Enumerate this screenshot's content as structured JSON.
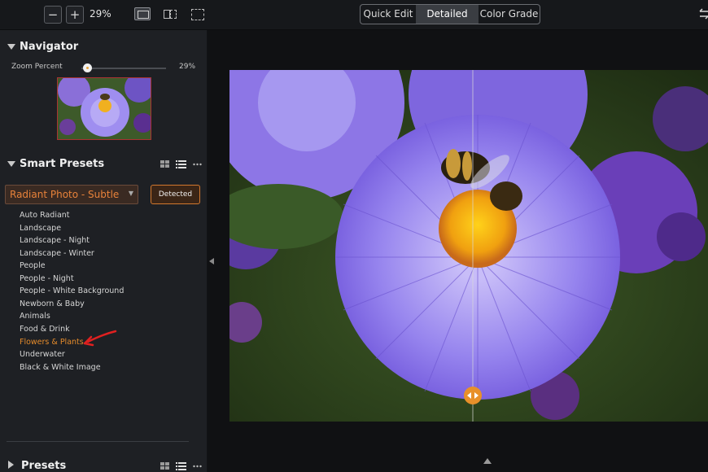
{
  "toolbar": {
    "zoom_out_label": "−",
    "zoom_in_label": "+",
    "zoom_value": "29%",
    "modes": [
      "Quick Edit",
      "Detailed Edit",
      "Color Grade"
    ],
    "active_mode": "Detailed Edit"
  },
  "navigator": {
    "title": "Navigator",
    "zoom_label": "Zoom Percent",
    "zoom_value": "29%",
    "zoom_fraction": 0.07
  },
  "smart_presets": {
    "title": "Smart Presets",
    "selected_preset": "Radiant Photo - Subtle",
    "detected_label": "Detected",
    "items": [
      "Auto Radiant",
      "Landscape",
      "Landscape - Night",
      "Landscape - Winter",
      "People",
      "People - Night",
      "People - White Background",
      "Newborn & Baby",
      "Animals",
      "Food & Drink",
      "Flowers & Plants",
      "Underwater",
      "Black & White Image"
    ],
    "highlighted_item": "Flowers & Plants",
    "highlight_color": "#e58b2b"
  },
  "presets": {
    "title": "Presets"
  },
  "colors": {
    "accent": "#e8823a",
    "arrow": "#e02020"
  }
}
